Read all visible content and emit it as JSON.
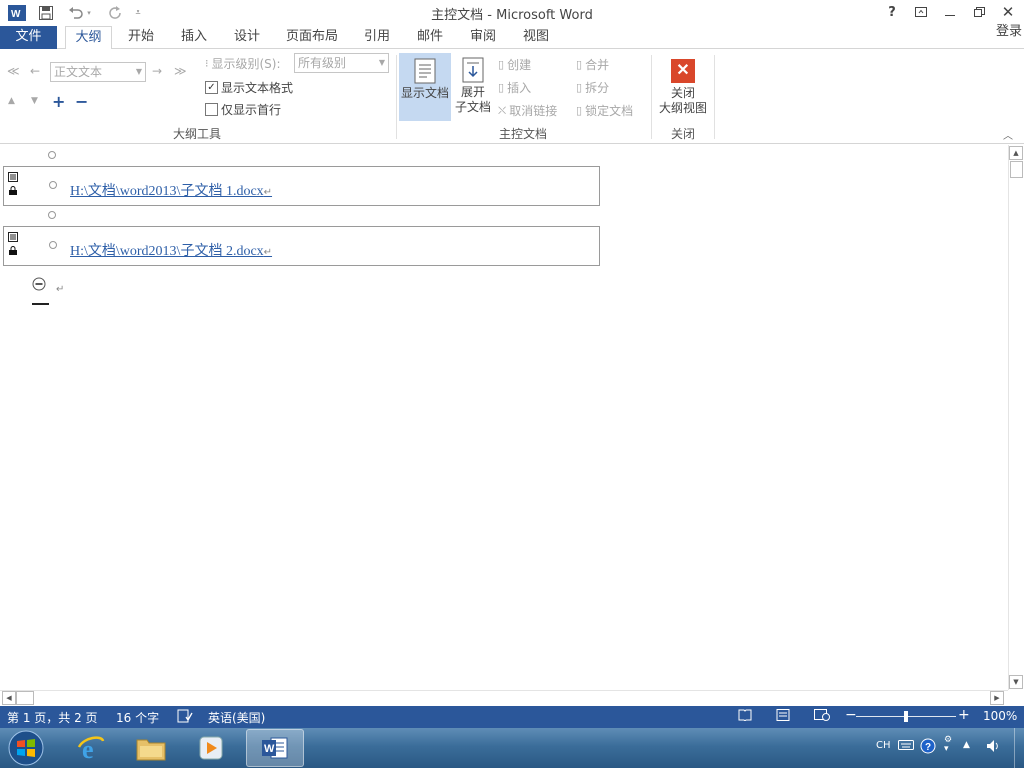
{
  "window": {
    "title": "主控文档 - Microsoft Word"
  },
  "tabs": {
    "file": "文件",
    "outline": "大纲",
    "home": "开始",
    "insert": "插入",
    "design": "设计",
    "layout": "页面布局",
    "references": "引用",
    "mailings": "邮件",
    "review": "审阅",
    "view": "视图"
  },
  "login": "登录",
  "ribbon": {
    "outline_tools": {
      "label": "大纲工具",
      "level_combo": "正文文本",
      "show_level_label": "显示级别(S):",
      "show_level_value": "所有级别",
      "show_text_format": "显示文本格式",
      "show_text_format_checked": true,
      "show_first_line": "仅显示首行",
      "show_first_line_checked": false
    },
    "master_document": {
      "label": "主控文档",
      "show_document": "显示文档",
      "expand_subdocuments_line1": "展开",
      "expand_subdocuments_line2": "子文档",
      "create": "创建",
      "insert": "插入",
      "unlink": "取消链接",
      "merge": "合并",
      "split": "拆分",
      "lock_document": "锁定文档"
    },
    "close": {
      "label": "关闭",
      "close_outline_line1": "关闭",
      "close_outline_line2": "大纲视图"
    }
  },
  "document": {
    "subdocs": [
      {
        "path": "H:\\文档\\word2013\\子文档 1.docx"
      },
      {
        "path": "H:\\文档\\word2013\\子文档 2.docx"
      }
    ],
    "pilcrow": "↵"
  },
  "status": {
    "page": "第 1 页，共 2 页",
    "words": "16 个字",
    "language": "英语(美国)",
    "zoom": "100%",
    "zoom_fraction": 0.5
  },
  "taskbar": {
    "tray_lang": "CH"
  },
  "colors": {
    "accent": "#2b579a",
    "link": "#2e5fa8",
    "close_red": "#d9472b"
  }
}
